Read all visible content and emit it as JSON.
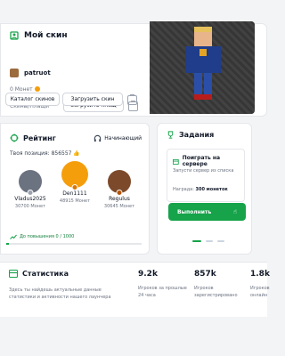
{
  "skin": {
    "title": "Мой скин",
    "username": "patruot",
    "coins": "0 Монет",
    "row1_label": "Скины/Плащи",
    "upload_cape": "Загрузить плащ",
    "catalog": "Каталог скинов",
    "upload_skin": "Загрузить скин"
  },
  "rating": {
    "title": "Рейтинг",
    "badge": "Начинающий",
    "your_position": "Твоя позиция: 856557",
    "players": [
      {
        "name": "Vladus2025",
        "points": "30700 Монет",
        "rank": "2"
      },
      {
        "name": "Den1111",
        "points": "48915 Монет",
        "rank": "1"
      },
      {
        "name": "Regulus",
        "points": "30645 Монет",
        "rank": "3"
      }
    ],
    "promotion": "До повышения 0 / 1000",
    "promotion_progress": 0.0
  },
  "tasks": {
    "title": "Задания",
    "task_name": "Поиграть на сервере",
    "task_desc": "Запусти сервер из списка",
    "reward_label": "Награда:",
    "reward_value": "300 монеток",
    "button": "Выполнить"
  },
  "stats": {
    "title": "Статистика",
    "description": "Здесь ты найдешь актуальные данные статистики и активности нашего лаунчера",
    "items": [
      {
        "value": "9.2k",
        "label": "Игроков за прошлые 24 часа"
      },
      {
        "value": "857k",
        "label": "Игроков зарегистрировано"
      },
      {
        "value": "1.8k",
        "label": "Игроков онлайн"
      }
    ]
  },
  "colors": {
    "accent": "#16a34a",
    "gold": "#f59e0b",
    "silver": "#9ca3af",
    "bronze": "#b45309"
  },
  "icons": [
    "skin-icon",
    "trash-icon",
    "rating-icon",
    "headphones-icon",
    "trophy-icon",
    "calendar-icon",
    "hand-pointer-icon",
    "stats-icon"
  ]
}
